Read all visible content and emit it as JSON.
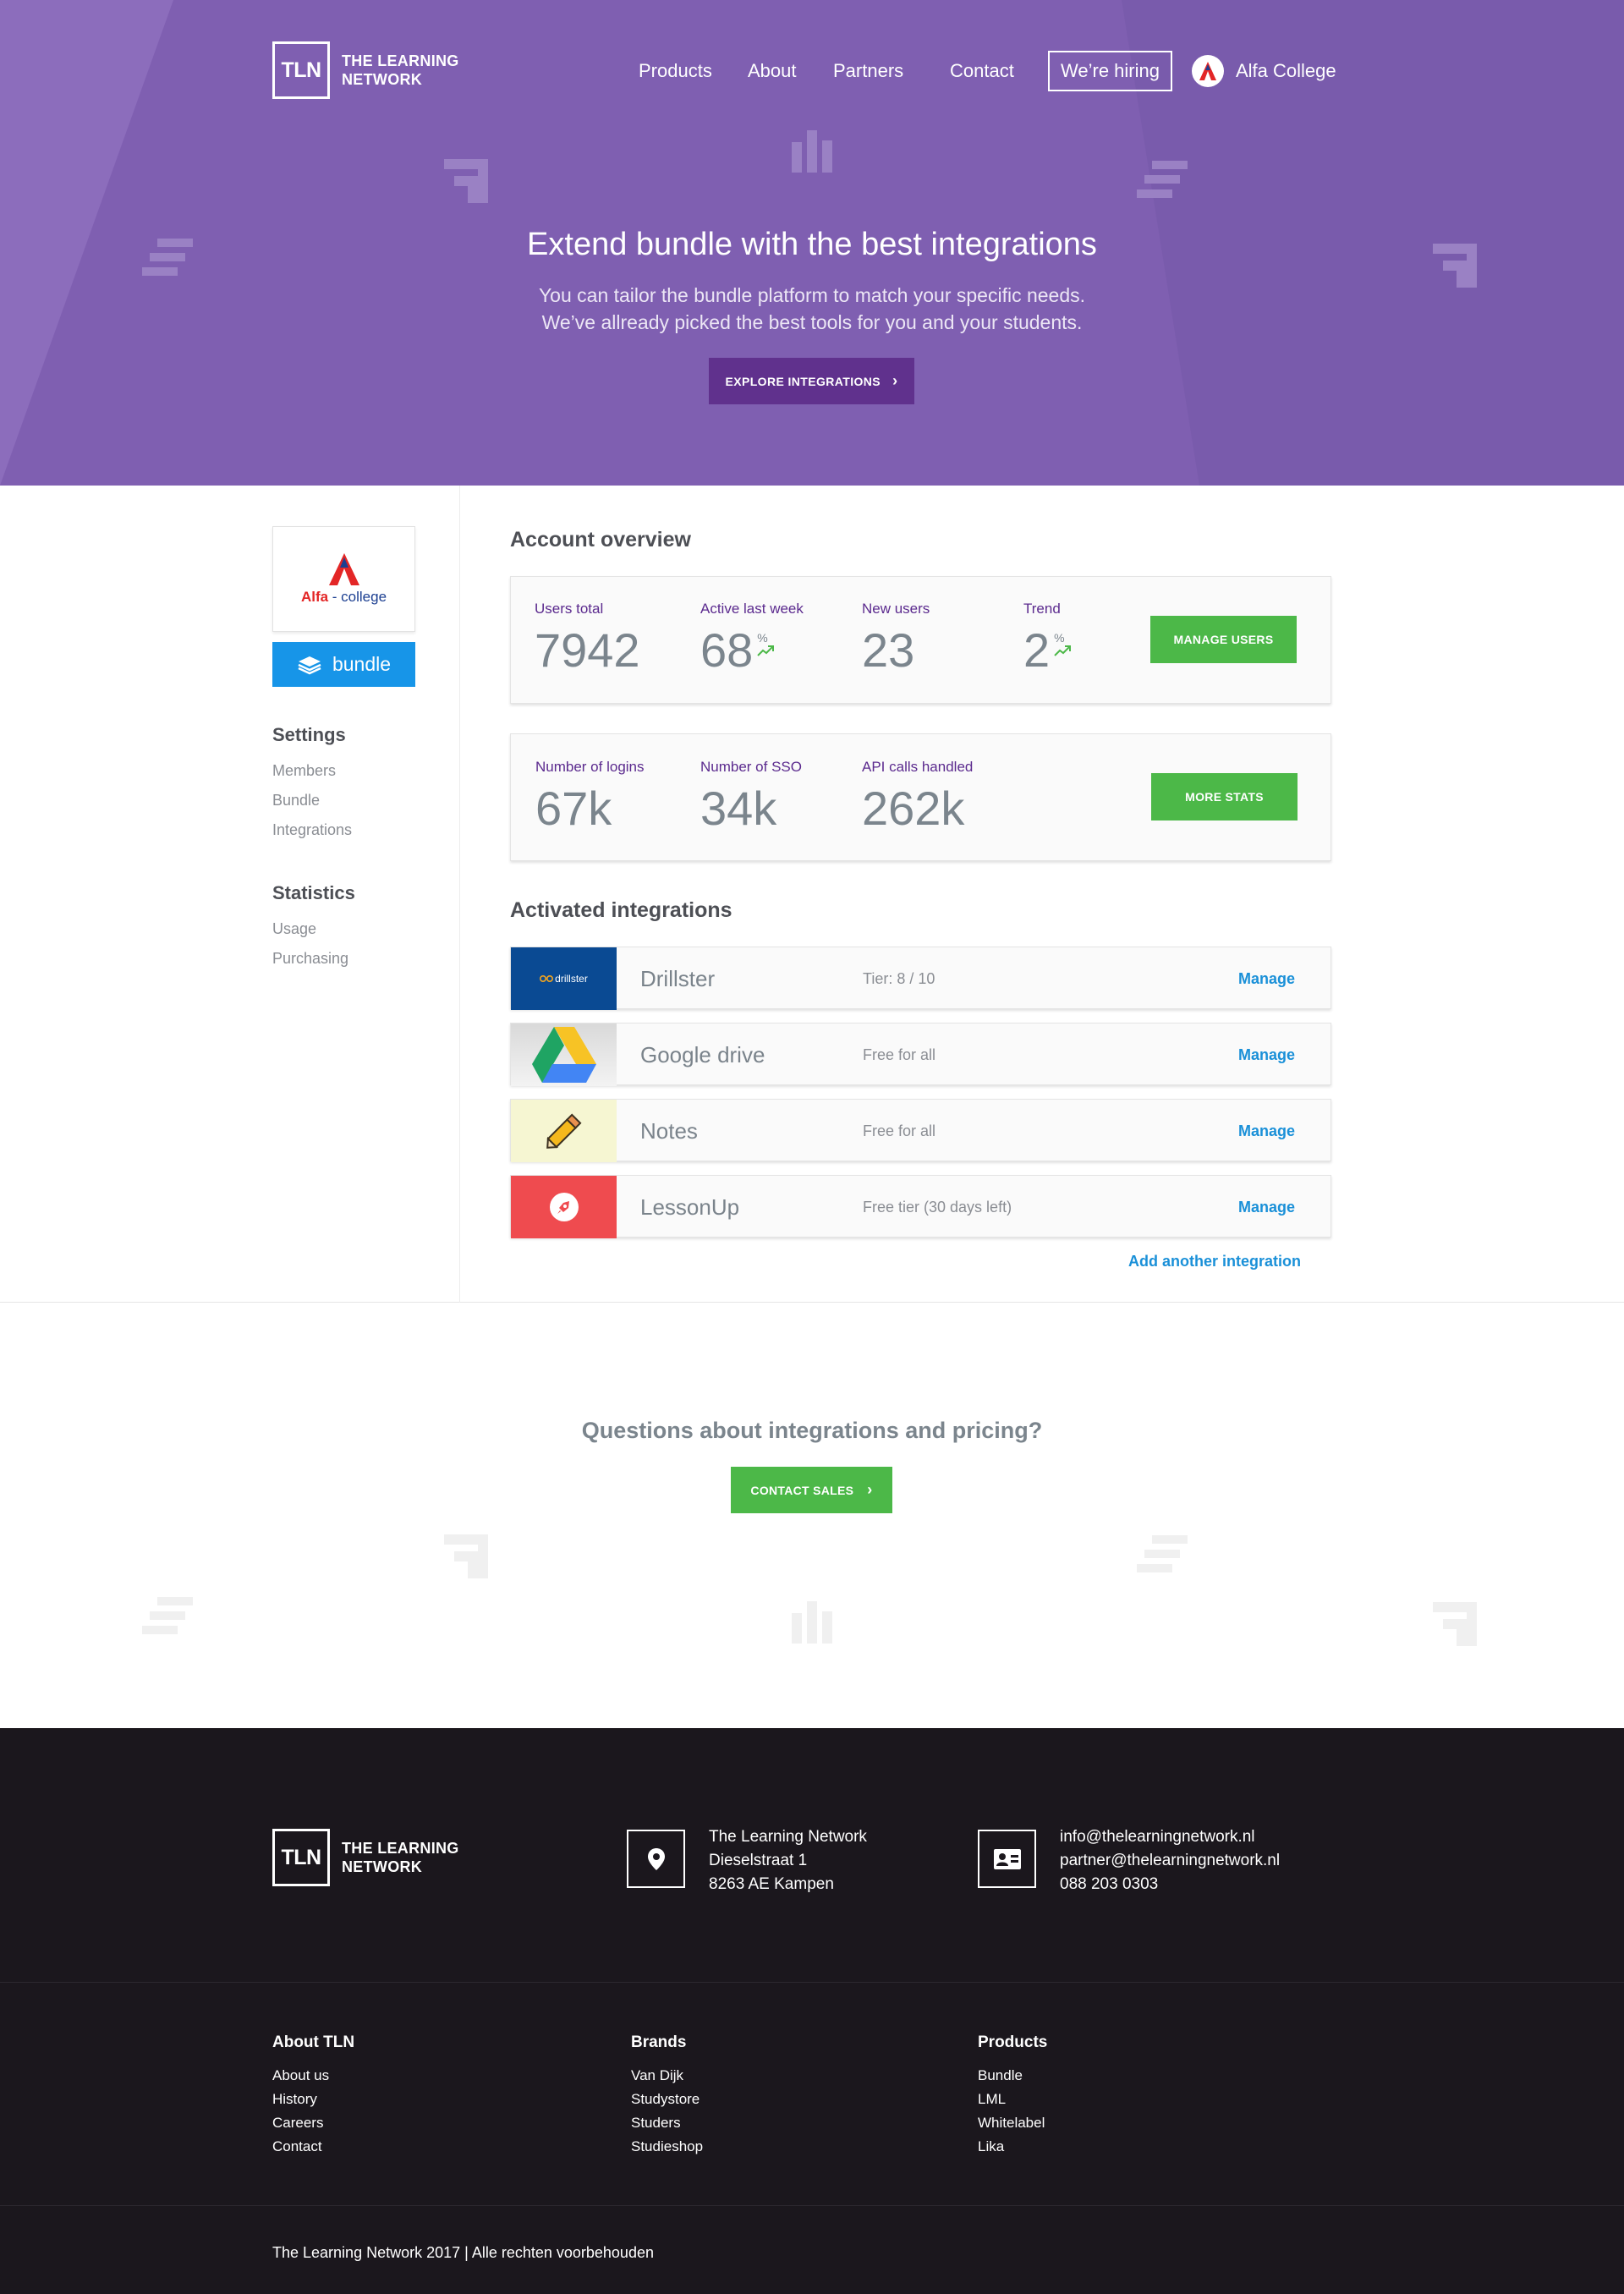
{
  "brand": {
    "logo_mark": "TLN",
    "line1": "THE LEARNING",
    "line2": "NETWORK"
  },
  "nav": {
    "items": [
      "Products",
      "About",
      "Partners",
      "Contact"
    ],
    "hiring": "We’re hiring",
    "user": "Alfa College"
  },
  "hero": {
    "title": "Extend bundle with the best integrations",
    "sub1": "You can tailor the bundle platform to match your specific needs.",
    "sub2": "We’ve allready picked the best tools for you and your students.",
    "button": "EXPLORE INTEGRATIONS"
  },
  "sidebar": {
    "org": {
      "name_a": "Alfa",
      "name_dash": " - ",
      "name_b": "college"
    },
    "bundle": "bundle",
    "settings_head": "Settings",
    "settings": [
      "Members",
      "Bundle",
      "Integrations"
    ],
    "statistics_head": "Statistics",
    "statistics": [
      "Usage",
      "Purchasing"
    ]
  },
  "overview": {
    "title": "Account overview",
    "row1": [
      {
        "label": "Users total",
        "value": "7942"
      },
      {
        "label": "Active last week",
        "value": "68",
        "unit": "%"
      },
      {
        "label": "New users",
        "value": "23"
      },
      {
        "label": "Trend",
        "value": "2",
        "unit": "%"
      }
    ],
    "row1_button": "MANAGE USERS",
    "row2": [
      {
        "label": "Number of logins",
        "value": "67k"
      },
      {
        "label": "Number of SSO",
        "value": "34k"
      },
      {
        "label": "API calls handled",
        "value": "262k"
      }
    ],
    "row2_button": "MORE STATS"
  },
  "integrations": {
    "title": "Activated integrations",
    "items": [
      {
        "name": "Drillster",
        "tier": "Tier:  8 / 10",
        "manage": "Manage",
        "logo_text": "drillster",
        "color": "#0a4a93"
      },
      {
        "name": "Google drive",
        "tier": "Free for all",
        "manage": "Manage",
        "color": "#d9d9d9"
      },
      {
        "name": "Notes",
        "tier": "Free for all",
        "manage": "Manage",
        "color": "#f6f6d2"
      },
      {
        "name": "LessonUp",
        "tier": "Free tier (30 days left)",
        "manage": "Manage",
        "color": "#ef4b4f"
      }
    ],
    "add": "Add another integration"
  },
  "cta": {
    "title": "Questions about integrations and pricing?",
    "button": "CONTACT SALES"
  },
  "footer": {
    "address": [
      "The Learning Network",
      "Dieselstraat 1",
      "8263 AE Kampen"
    ],
    "contact": [
      "info@thelearningnetwork.nl",
      "partner@thelearningnetwork.nl",
      "088 203 0303"
    ],
    "columns": [
      {
        "head": "About TLN",
        "links": [
          "About us",
          "History",
          "Careers",
          "Contact"
        ]
      },
      {
        "head": "Brands",
        "links": [
          "Van Dijk",
          "Studystore",
          "Studers",
          "Studieshop"
        ]
      },
      {
        "head": "Products",
        "links": [
          "Bundle",
          "LML",
          "Whitelabel",
          "Lika"
        ]
      }
    ],
    "copyright": "The Learning Network 2017 | Alle rechten voorbehouden"
  },
  "colors": {
    "hero": "#7f5fb1",
    "accent_purple": "#60318d",
    "green": "#4cb848",
    "blue": "#1795e8",
    "footer": "#1b171d"
  },
  "icons": [
    "location-pin-icon",
    "contact-card-icon",
    "chevron-right-icon",
    "trend-up-icon",
    "stack-icon"
  ]
}
